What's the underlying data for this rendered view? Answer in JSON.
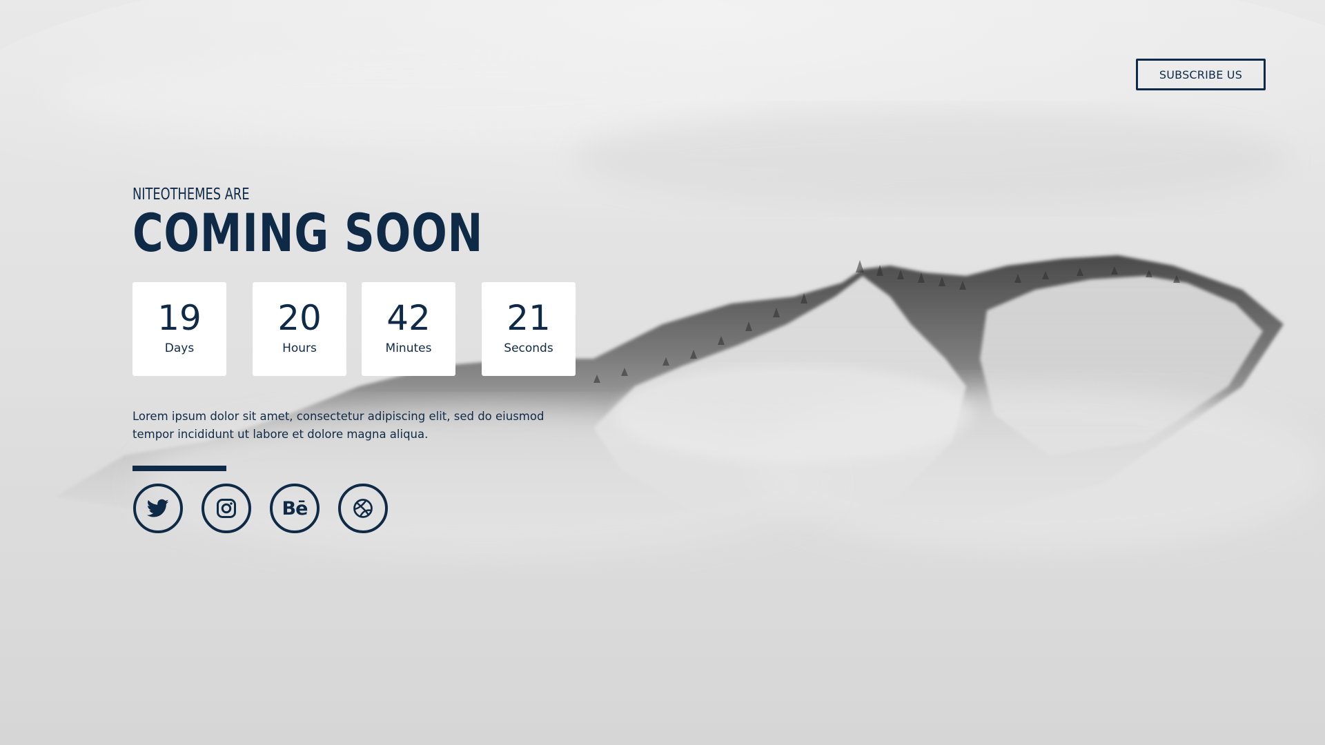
{
  "header": {
    "subscribe_label": "SUBSCRIBE US"
  },
  "hero": {
    "subtitle": "NITEOTHEMES ARE",
    "title": "COMING SOON"
  },
  "countdown": [
    {
      "value": "19",
      "label": "Days"
    },
    {
      "value": "20",
      "label": "Hours"
    },
    {
      "value": "42",
      "label": "Minutes"
    },
    {
      "value": "21",
      "label": "Seconds"
    }
  ],
  "description": "Lorem ipsum dolor sit amet, consectetur adipiscing elit, sed do eiusmod tempor incididunt ut labore et dolore magna aliqua.",
  "social": [
    {
      "icon": "twitter-icon"
    },
    {
      "icon": "instagram-icon"
    },
    {
      "icon": "behance-icon",
      "text": "Bē"
    },
    {
      "icon": "dribbble-icon"
    }
  ],
  "colors": {
    "primary": "#0f2a47",
    "box_bg": "#ffffff",
    "background": "#dcdcdc"
  }
}
